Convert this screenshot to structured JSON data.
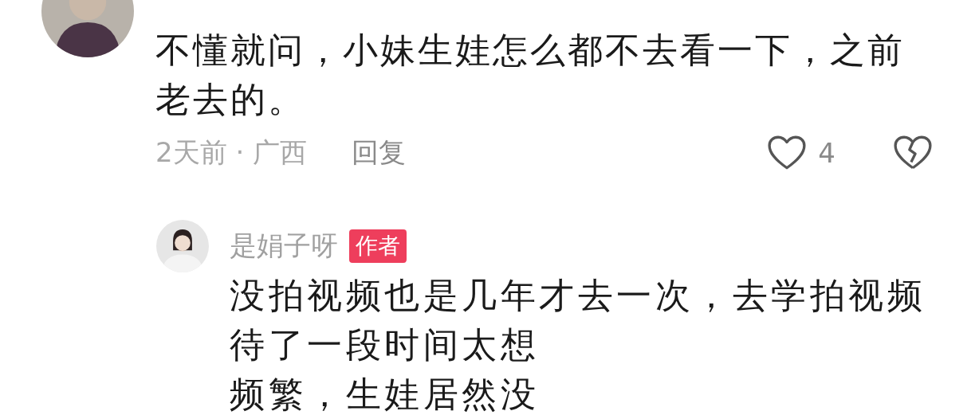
{
  "comment": {
    "text_lines": [
      "不懂就问，小妹生娃怎么都不去看一下，之前",
      "老去的。"
    ],
    "time": "2天前",
    "separator": "·",
    "location": "广西",
    "reply_label": "回复",
    "likes": "4"
  },
  "reply": {
    "name": "是娟子呀",
    "badge": "作者",
    "text_lines": [
      "没拍视频也是几年才去一次，去学拍视频",
      "待了一段时间太想",
      "频繁，生娃居然没"
    ]
  }
}
